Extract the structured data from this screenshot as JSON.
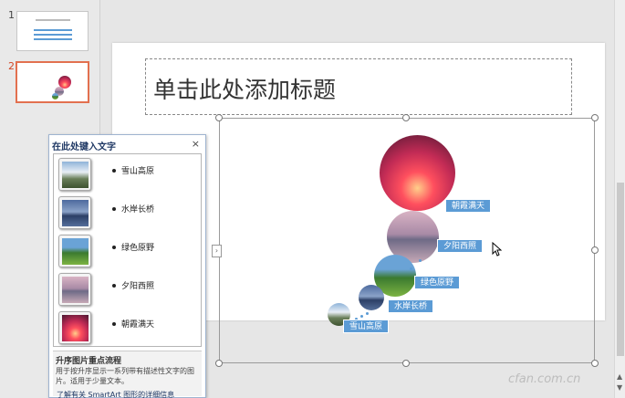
{
  "thumbnails": [
    {
      "number": "1"
    },
    {
      "number": "2"
    }
  ],
  "slide": {
    "title_placeholder": "单击此处添加标题"
  },
  "smartart": {
    "items": [
      {
        "label": "朝霞满天",
        "image": "sunrise-photo"
      },
      {
        "label": "夕阳西照",
        "image": "sunset-lake-photo"
      },
      {
        "label": "绿色原野",
        "image": "green-field-photo"
      },
      {
        "label": "水岸长桥",
        "image": "bridge-photo"
      },
      {
        "label": "雪山高原",
        "image": "snow-mountain-photo"
      }
    ]
  },
  "text_pane": {
    "title": "在此处键入文字",
    "close": "×",
    "items": [
      "雪山高原",
      "水岸长桥",
      "绿色原野",
      "夕阳西照",
      "朝霞满天"
    ],
    "desc_title": "升序图片重点流程",
    "desc_body": "用于按升序显示一系列带有描述性文字的图片。适用于少量文本。",
    "link": "了解有关 SmartArt 图形的详细信息"
  },
  "expander_glyph": "›",
  "watermark": "cfan.com.cn",
  "colors": {
    "accent": "#5b9bd5",
    "selected_border": "#e2704f"
  }
}
